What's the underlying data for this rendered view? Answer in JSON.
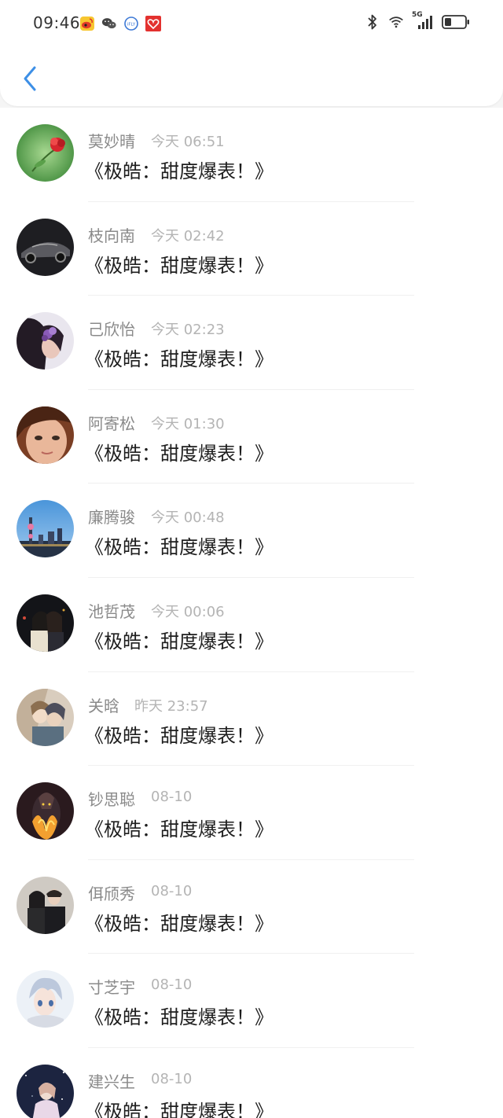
{
  "status_bar": {
    "time": "09:46",
    "left_icons": [
      "weibo-icon",
      "wechat-icon",
      "iflytek-icon",
      "red-heart-app-icon"
    ],
    "right_icons": [
      "bluetooth-icon",
      "wifi-icon",
      "5g-signal-icon",
      "battery-icon"
    ],
    "network_label": "5G"
  },
  "nav": {
    "back_icon": "chevron-left-icon"
  },
  "messages": [
    {
      "name": "莫妙晴",
      "time": "今天 06:51",
      "text": "《极皓：甜度爆表！》",
      "avatar_desc": "red-flower-avatar"
    },
    {
      "name": "枝向南",
      "time": "今天 02:42",
      "text": "《极皓：甜度爆表！》",
      "avatar_desc": "sports-car-avatar"
    },
    {
      "name": "己欣怡",
      "time": "今天 02:23",
      "text": "《极皓：甜度爆表！》",
      "avatar_desc": "girl-with-flowers-avatar"
    },
    {
      "name": "阿寄松",
      "time": "今天 01:30",
      "text": "《极皓：甜度爆表！》",
      "avatar_desc": "face-closeup-avatar"
    },
    {
      "name": "廉腾骏",
      "time": "今天 00:48",
      "text": "《极皓：甜度爆表！》",
      "avatar_desc": "city-skyline-avatar"
    },
    {
      "name": "池哲茂",
      "time": "今天 00:06",
      "text": "《极皓：甜度爆表！》",
      "avatar_desc": "couple-night-avatar"
    },
    {
      "name": "关晗",
      "time": "昨天 23:57",
      "text": "《极皓：甜度爆表！》",
      "avatar_desc": "anime-couple-avatar"
    },
    {
      "name": "钞思聪",
      "time": "08-10",
      "text": "《极皓：甜度爆表！》",
      "avatar_desc": "flame-hero-avatar"
    },
    {
      "name": "佴颀秀",
      "time": "08-10",
      "text": "《极皓：甜度爆表！》",
      "avatar_desc": "couple-photo-avatar"
    },
    {
      "name": "寸芝宇",
      "time": "08-10",
      "text": "《极皓：甜度爆表！》",
      "avatar_desc": "anime-boy-avatar"
    },
    {
      "name": "建兴生",
      "time": "08-10",
      "text": "《极皓：甜度爆表！》",
      "avatar_desc": "starry-girl-avatar"
    }
  ],
  "colors": {
    "accent": "#3d8fe6",
    "name_text": "#8a8a8a",
    "time_text": "#b4b4b4",
    "message_text": "#1e1e1e",
    "background": "#f5f5f5"
  }
}
